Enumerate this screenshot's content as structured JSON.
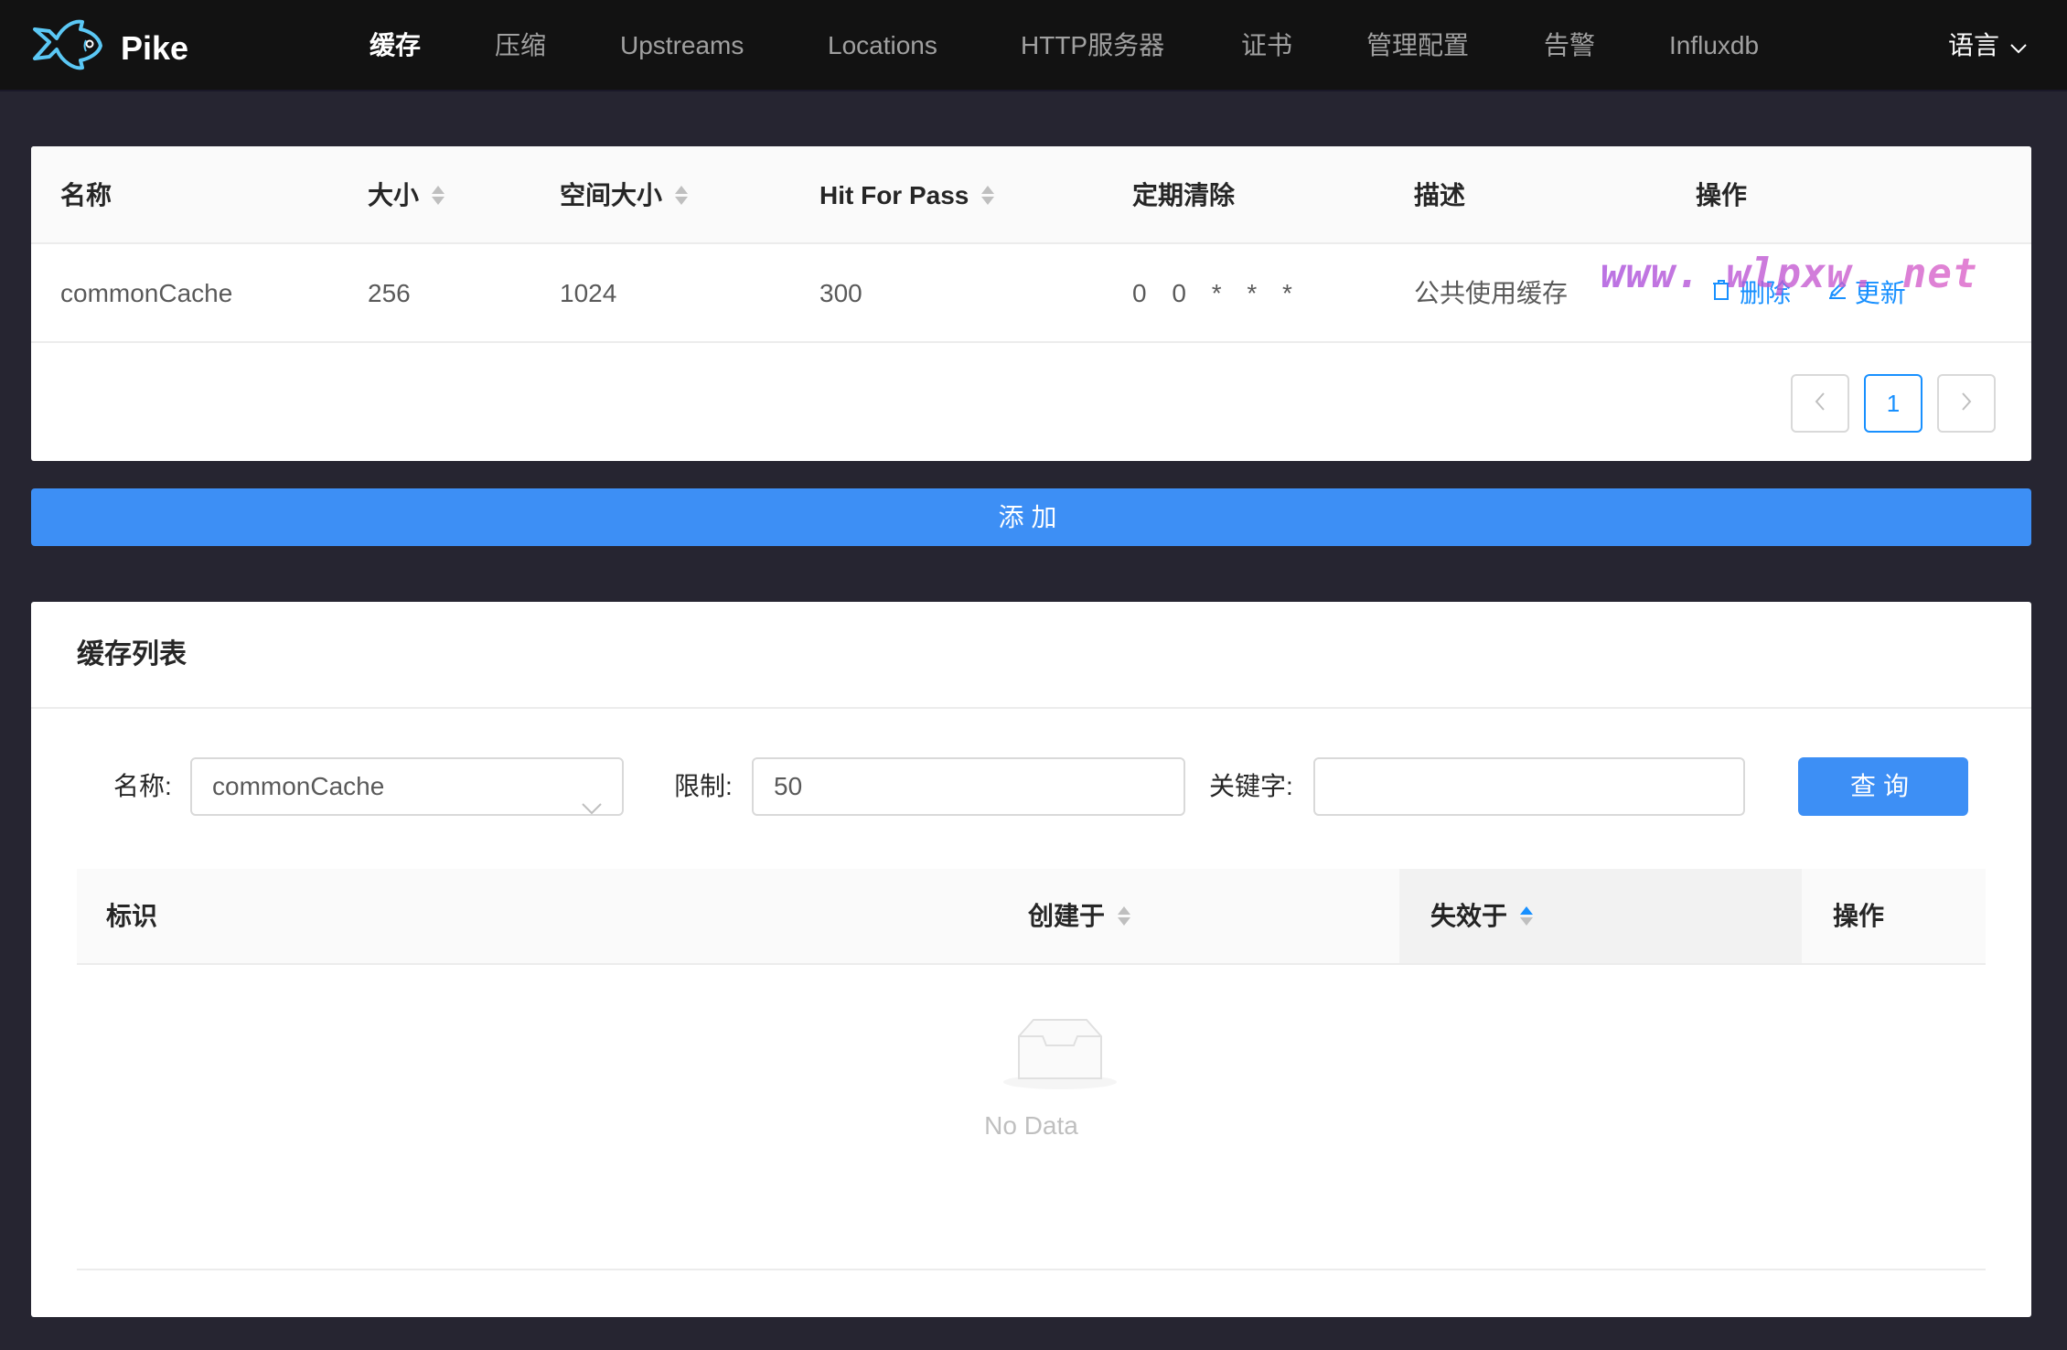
{
  "app": {
    "name": "Pike",
    "logo_icon": "fish-icon"
  },
  "nav": {
    "items": [
      {
        "label": "缓存",
        "active": true
      },
      {
        "label": "压缩",
        "active": false
      },
      {
        "label": "Upstreams",
        "active": false
      },
      {
        "label": "Locations",
        "active": false
      },
      {
        "label": "HTTP服务器",
        "active": false
      },
      {
        "label": "证书",
        "active": false
      },
      {
        "label": "管理配置",
        "active": false
      },
      {
        "label": "告警",
        "active": false
      },
      {
        "label": "Influxdb",
        "active": false
      }
    ],
    "language_label": "语言",
    "language_icon": "chevron-down-icon"
  },
  "cache_table": {
    "columns": [
      {
        "label": "名称",
        "sortable": false
      },
      {
        "label": "大小",
        "sortable": true
      },
      {
        "label": "空间大小",
        "sortable": true
      },
      {
        "label": "Hit For Pass",
        "sortable": true
      },
      {
        "label": "定期清除",
        "sortable": false
      },
      {
        "label": "描述",
        "sortable": false
      },
      {
        "label": "操作",
        "sortable": false
      }
    ],
    "rows": [
      {
        "name": "commonCache",
        "size": "256",
        "space_size": "1024",
        "hit_for_pass": "300",
        "purge_schedule": "0 0 * * *",
        "description": "公共使用缓存",
        "actions": [
          {
            "label": "删除",
            "icon": "trash-icon"
          },
          {
            "label": "更新",
            "icon": "edit-icon"
          }
        ]
      }
    ],
    "pagination": {
      "prev_icon": "chevron-left-icon",
      "current_page": "1",
      "next_icon": "chevron-right-icon"
    }
  },
  "watermark": "www. wlpxw. net",
  "add_button_label": "添加",
  "cache_list": {
    "title": "缓存列表",
    "filters": {
      "name_label": "名称:",
      "name_value": "commonCache",
      "limit_label": "限制:",
      "limit_value": "50",
      "keyword_label": "关键字:",
      "keyword_value": "",
      "query_label": "查询"
    },
    "columns": [
      {
        "label": "标识",
        "sortable": false
      },
      {
        "label": "创建于",
        "sortable": true,
        "sort": "none"
      },
      {
        "label": "失效于",
        "sortable": true,
        "sort": "ascend"
      },
      {
        "label": "操作",
        "sortable": false
      }
    ],
    "empty_text": "No Data",
    "empty_icon": "inbox-empty-icon"
  },
  "colors": {
    "primary": "#1890ff",
    "button_blue": "#3d8ff5",
    "header_bg": "#121212",
    "page_bg": "#262531"
  }
}
